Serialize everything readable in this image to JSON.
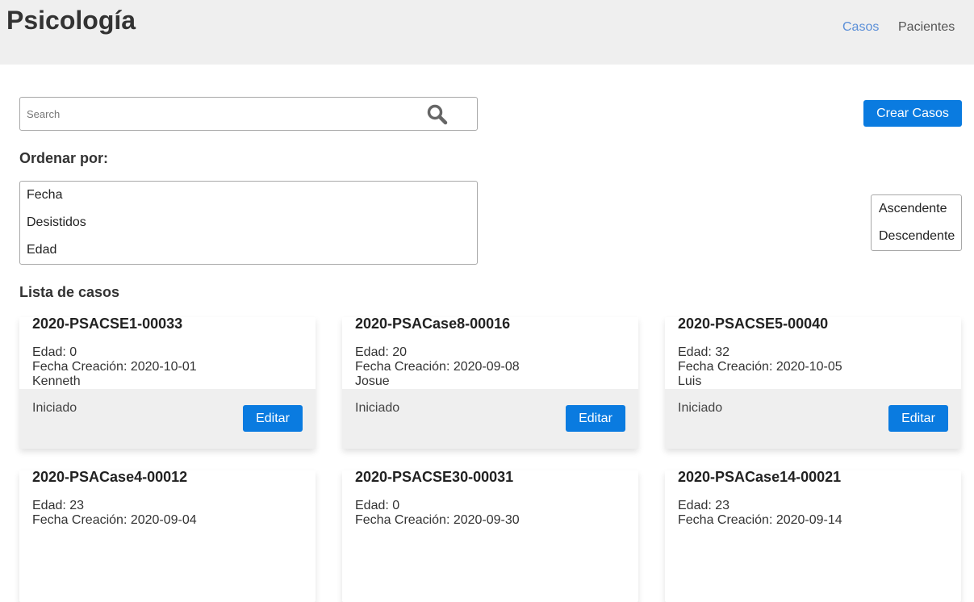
{
  "header": {
    "title": "Psicología",
    "nav": [
      {
        "label": "Casos",
        "active": true
      },
      {
        "label": "Pacientes",
        "active": false
      }
    ]
  },
  "search": {
    "placeholder": "Search",
    "value": "",
    "icon": "search-icon"
  },
  "create_button": "Crear Casos",
  "sort": {
    "label": "Ordenar por:",
    "options": [
      "Fecha",
      "Desistidos",
      "Edad"
    ],
    "order_options": [
      "Ascendente",
      "Descendente"
    ]
  },
  "cases": {
    "title": "Lista de casos",
    "edit_label": "Editar",
    "items": [
      {
        "id": "2020-PSACSE1-00033",
        "age": "Edad: 0",
        "created": "Fecha Creación: 2020-10-01",
        "name": "Kenneth",
        "status": "Iniciado"
      },
      {
        "id": "2020-PSACase8-00016",
        "age": "Edad: 20",
        "created": "Fecha Creación: 2020-09-08",
        "name": "Josue",
        "status": "Iniciado"
      },
      {
        "id": "2020-PSACSE5-00040",
        "age": "Edad: 32",
        "created": "Fecha Creación: 2020-10-05",
        "name": "Luis",
        "status": "Iniciado"
      },
      {
        "id": "2020-PSACase4-00012",
        "age": "Edad: 23",
        "created": "Fecha Creación: 2020-09-04",
        "name": "",
        "status": ""
      },
      {
        "id": "2020-PSACSE30-00031",
        "age": "Edad: 0",
        "created": "Fecha Creación: 2020-09-30",
        "name": "",
        "status": ""
      },
      {
        "id": "2020-PSACase14-00021",
        "age": "Edad: 23",
        "created": "Fecha Creación: 2020-09-14",
        "name": "",
        "status": ""
      }
    ]
  },
  "colors": {
    "header_bg": "#efefef",
    "accent": "#0a7be0",
    "nav_active": "#5b8fd8",
    "card_footer_bg": "#efefef"
  }
}
